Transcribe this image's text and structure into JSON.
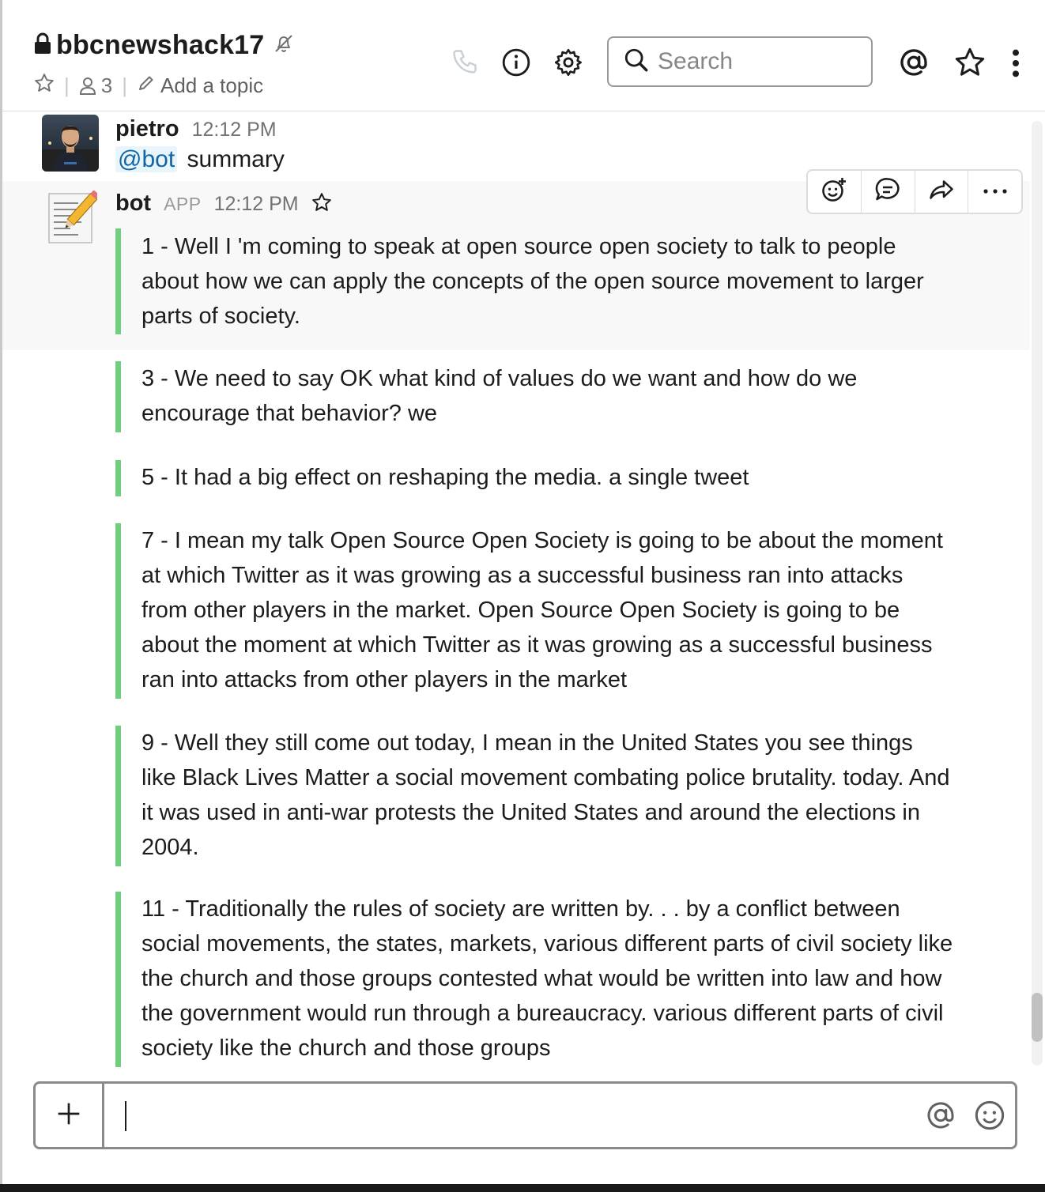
{
  "header": {
    "channel_name": "bbcnewshack17",
    "member_count": "3",
    "add_topic_label": "Add a topic",
    "search_placeholder": "Search",
    "icons": [
      "lock-icon",
      "mute-icon",
      "star-icon",
      "member-icon",
      "pencil-icon",
      "phone-icon",
      "info-icon",
      "gear-icon",
      "search-icon",
      "mention-icon",
      "star-icon",
      "more-vertical-icon"
    ]
  },
  "messages": [
    {
      "author": "pietro",
      "time": "12:12 PM",
      "mention": "@bot",
      "text": "summary"
    },
    {
      "author": "bot",
      "badge": "APP",
      "time": "12:12 PM",
      "attachments": [
        "1 - Well I 'm coming to speak at open source open society to talk to people about how we can apply the concepts of the open source movement to larger parts of society.",
        "3 -  We need to say OK what kind of values do we want and how do we encourage that behavior? we",
        "5 - It had a big effect on reshaping the media. a single tweet",
        "7 - I mean my talk Open Source Open Society is going to be about the moment at which Twitter as it was growing as a successful business ran into attacks from other players in the market. Open Source Open Society is going to be about the moment at which Twitter as it was growing as a successful business ran into attacks from other players in the market",
        "9 - Well they still come out today, I mean in the United States you see things like Black Lives Matter a social movement combating police brutality. today. And it was used in anti-war protests the United States and around the elections in 2004.",
        "11 -  Traditionally the rules of society are written by. . . by a conflict between social movements, the states, markets, various different parts of civil society like the church and those groups contested what would be written into law and how the government would run through a bureaucracy. various different parts of civil society like the church and those groups"
      ]
    }
  ],
  "message_actions": [
    "add-reaction-icon",
    "start-thread-icon",
    "share-icon",
    "more-actions-icon"
  ],
  "composer": {
    "value": "",
    "icons": [
      "plus-icon",
      "mention-icon",
      "emoji-icon"
    ]
  },
  "colors": {
    "attachment_bar": "#6fcf7f",
    "mention_text": "#1264a3",
    "mention_bg": "#e8f5fa"
  }
}
